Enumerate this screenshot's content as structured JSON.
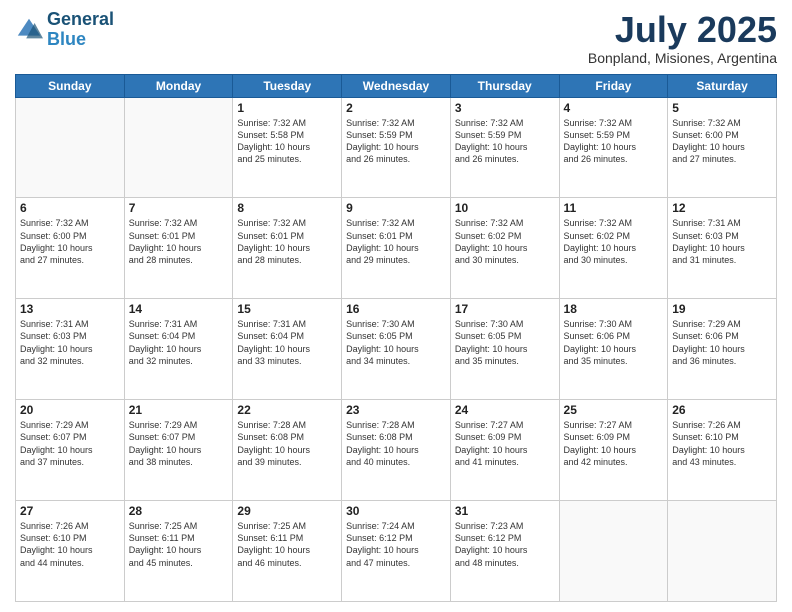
{
  "header": {
    "logo_line1": "General",
    "logo_line2": "Blue",
    "month_year": "July 2025",
    "location": "Bonpland, Misiones, Argentina"
  },
  "days_of_week": [
    "Sunday",
    "Monday",
    "Tuesday",
    "Wednesday",
    "Thursday",
    "Friday",
    "Saturday"
  ],
  "weeks": [
    [
      {
        "day": "",
        "info": ""
      },
      {
        "day": "",
        "info": ""
      },
      {
        "day": "1",
        "info": "Sunrise: 7:32 AM\nSunset: 5:58 PM\nDaylight: 10 hours\nand 25 minutes."
      },
      {
        "day": "2",
        "info": "Sunrise: 7:32 AM\nSunset: 5:59 PM\nDaylight: 10 hours\nand 26 minutes."
      },
      {
        "day": "3",
        "info": "Sunrise: 7:32 AM\nSunset: 5:59 PM\nDaylight: 10 hours\nand 26 minutes."
      },
      {
        "day": "4",
        "info": "Sunrise: 7:32 AM\nSunset: 5:59 PM\nDaylight: 10 hours\nand 26 minutes."
      },
      {
        "day": "5",
        "info": "Sunrise: 7:32 AM\nSunset: 6:00 PM\nDaylight: 10 hours\nand 27 minutes."
      }
    ],
    [
      {
        "day": "6",
        "info": "Sunrise: 7:32 AM\nSunset: 6:00 PM\nDaylight: 10 hours\nand 27 minutes."
      },
      {
        "day": "7",
        "info": "Sunrise: 7:32 AM\nSunset: 6:01 PM\nDaylight: 10 hours\nand 28 minutes."
      },
      {
        "day": "8",
        "info": "Sunrise: 7:32 AM\nSunset: 6:01 PM\nDaylight: 10 hours\nand 28 minutes."
      },
      {
        "day": "9",
        "info": "Sunrise: 7:32 AM\nSunset: 6:01 PM\nDaylight: 10 hours\nand 29 minutes."
      },
      {
        "day": "10",
        "info": "Sunrise: 7:32 AM\nSunset: 6:02 PM\nDaylight: 10 hours\nand 30 minutes."
      },
      {
        "day": "11",
        "info": "Sunrise: 7:32 AM\nSunset: 6:02 PM\nDaylight: 10 hours\nand 30 minutes."
      },
      {
        "day": "12",
        "info": "Sunrise: 7:31 AM\nSunset: 6:03 PM\nDaylight: 10 hours\nand 31 minutes."
      }
    ],
    [
      {
        "day": "13",
        "info": "Sunrise: 7:31 AM\nSunset: 6:03 PM\nDaylight: 10 hours\nand 32 minutes."
      },
      {
        "day": "14",
        "info": "Sunrise: 7:31 AM\nSunset: 6:04 PM\nDaylight: 10 hours\nand 32 minutes."
      },
      {
        "day": "15",
        "info": "Sunrise: 7:31 AM\nSunset: 6:04 PM\nDaylight: 10 hours\nand 33 minutes."
      },
      {
        "day": "16",
        "info": "Sunrise: 7:30 AM\nSunset: 6:05 PM\nDaylight: 10 hours\nand 34 minutes."
      },
      {
        "day": "17",
        "info": "Sunrise: 7:30 AM\nSunset: 6:05 PM\nDaylight: 10 hours\nand 35 minutes."
      },
      {
        "day": "18",
        "info": "Sunrise: 7:30 AM\nSunset: 6:06 PM\nDaylight: 10 hours\nand 35 minutes."
      },
      {
        "day": "19",
        "info": "Sunrise: 7:29 AM\nSunset: 6:06 PM\nDaylight: 10 hours\nand 36 minutes."
      }
    ],
    [
      {
        "day": "20",
        "info": "Sunrise: 7:29 AM\nSunset: 6:07 PM\nDaylight: 10 hours\nand 37 minutes."
      },
      {
        "day": "21",
        "info": "Sunrise: 7:29 AM\nSunset: 6:07 PM\nDaylight: 10 hours\nand 38 minutes."
      },
      {
        "day": "22",
        "info": "Sunrise: 7:28 AM\nSunset: 6:08 PM\nDaylight: 10 hours\nand 39 minutes."
      },
      {
        "day": "23",
        "info": "Sunrise: 7:28 AM\nSunset: 6:08 PM\nDaylight: 10 hours\nand 40 minutes."
      },
      {
        "day": "24",
        "info": "Sunrise: 7:27 AM\nSunset: 6:09 PM\nDaylight: 10 hours\nand 41 minutes."
      },
      {
        "day": "25",
        "info": "Sunrise: 7:27 AM\nSunset: 6:09 PM\nDaylight: 10 hours\nand 42 minutes."
      },
      {
        "day": "26",
        "info": "Sunrise: 7:26 AM\nSunset: 6:10 PM\nDaylight: 10 hours\nand 43 minutes."
      }
    ],
    [
      {
        "day": "27",
        "info": "Sunrise: 7:26 AM\nSunset: 6:10 PM\nDaylight: 10 hours\nand 44 minutes."
      },
      {
        "day": "28",
        "info": "Sunrise: 7:25 AM\nSunset: 6:11 PM\nDaylight: 10 hours\nand 45 minutes."
      },
      {
        "day": "29",
        "info": "Sunrise: 7:25 AM\nSunset: 6:11 PM\nDaylight: 10 hours\nand 46 minutes."
      },
      {
        "day": "30",
        "info": "Sunrise: 7:24 AM\nSunset: 6:12 PM\nDaylight: 10 hours\nand 47 minutes."
      },
      {
        "day": "31",
        "info": "Sunrise: 7:23 AM\nSunset: 6:12 PM\nDaylight: 10 hours\nand 48 minutes."
      },
      {
        "day": "",
        "info": ""
      },
      {
        "day": "",
        "info": ""
      }
    ]
  ]
}
